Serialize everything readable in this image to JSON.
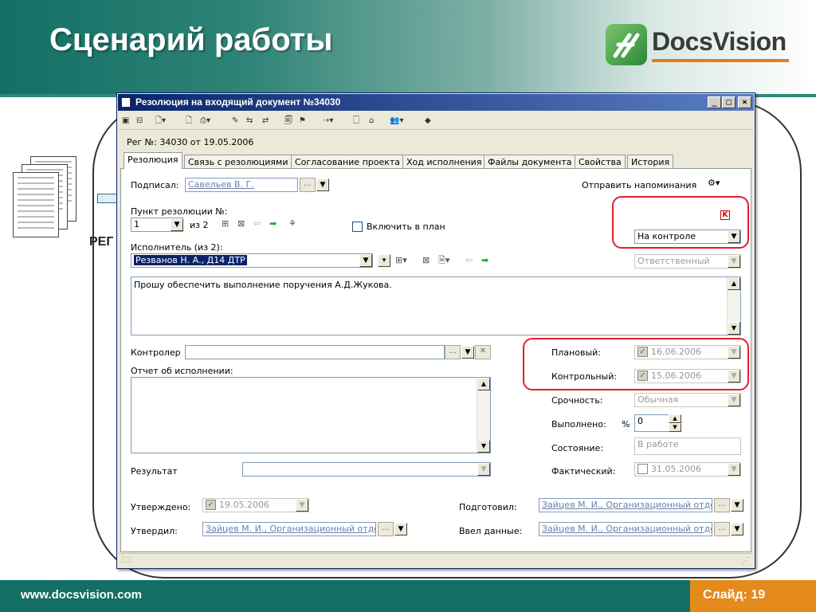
{
  "slide": {
    "title": "Сценарий работы",
    "logo_text": "DocsVision",
    "footer_url": "www.docsvision.com",
    "slide_number": "Слайд: 19",
    "bg_label": "РЕГ"
  },
  "window": {
    "title": "Резолюция на входящий документ №34030",
    "min": "_",
    "max": "□",
    "close": "×",
    "reg_info": "Рег №: 34030 от 19.05.2006"
  },
  "tabs": [
    "Резолюция",
    "Связь с резолюциями",
    "Согласование проекта",
    "Ход исполнения",
    "Файлы документа",
    "Свойства",
    "История"
  ],
  "form": {
    "signed_label": "Подписал:",
    "signed_value": "Савельев В. Г.",
    "send_reminder": "Отправить напоминания",
    "resolution_point_label": "Пункт резолюции №:",
    "resolution_point_value": "1",
    "of_total": "из 2",
    "include_plan": "Включить в план",
    "control_status": "На контроле",
    "executor_label": "Исполнитель (из 2):",
    "executor_value": "Резванов Н. А., Д14 ДТР",
    "executor_role": "Ответственный",
    "task_text": "Прошу обеспечить выполнение  поручения А.Д.Жукова.",
    "controller_label": "Контролер",
    "report_label": "Отчет об исполнении:",
    "planned_label": "Плановый:",
    "planned_value": "16.06.2006",
    "control_label": "Контрольный:",
    "control_value": "15.06.2006",
    "urgency_label": "Срочность:",
    "urgency_value": "Обычная",
    "done_label": "Выполнено:",
    "done_pct": "%",
    "done_value": "0",
    "state_label": "Состояние:",
    "state_value": "В работе",
    "result_label": "Результат",
    "actual_label": "Фактический:",
    "actual_value": "31.05.2006",
    "approved_label": "Утверждено:",
    "approved_value": "19.05.2006",
    "prepared_label": "Подготовил:",
    "prepared_value": "Зайцев М. И., Организационный отдел",
    "approver_label": "Утвердил:",
    "approver_value": "Зайцев М. И., Организационный отдел",
    "entered_label": "Ввел данные:",
    "entered_value": "Зайцев М. И., Организационный отдел"
  },
  "colors": {
    "accent_teal": "#136f64",
    "footer_orange": "#e58a1c",
    "highlight_red": "#e0202a",
    "title_blue": "#0a246a"
  }
}
